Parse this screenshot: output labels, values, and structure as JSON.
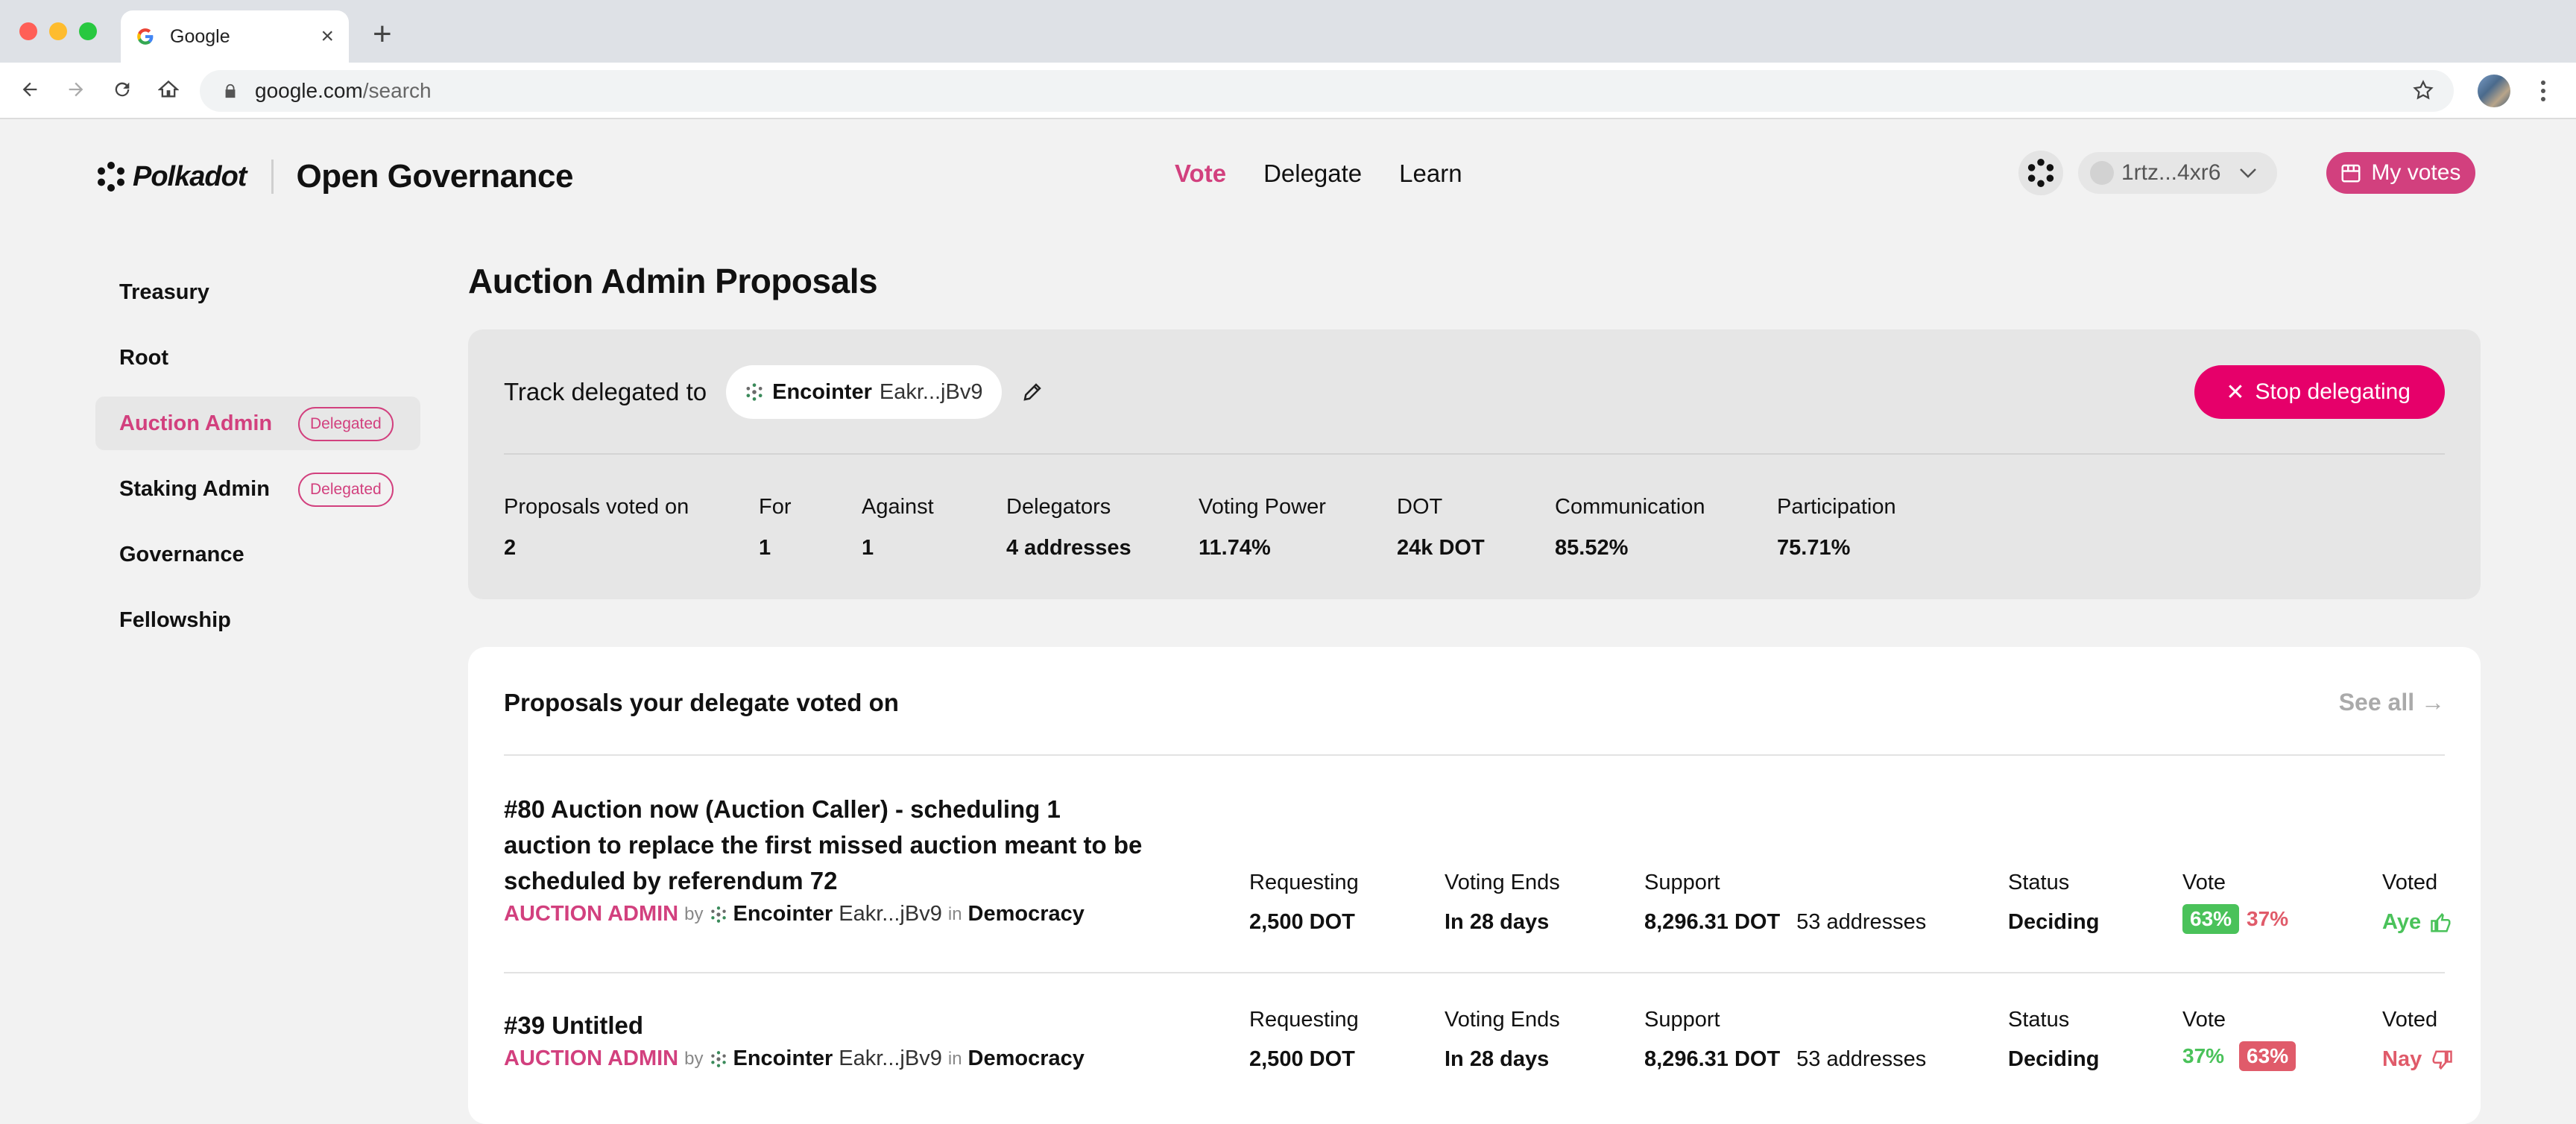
{
  "browser": {
    "tab_title": "Google",
    "url_host": "google.com",
    "url_path": "/search"
  },
  "header": {
    "brand": "Polkadot",
    "app_title": "Open Governance",
    "nav": [
      "Vote",
      "Delegate",
      "Learn"
    ],
    "active_nav": "Vote",
    "account": "1rtz...4xr6",
    "my_votes": "My votes"
  },
  "sidebar": {
    "items": [
      {
        "label": "Treasury",
        "badge": ""
      },
      {
        "label": "Root",
        "badge": ""
      },
      {
        "label": "Auction Admin",
        "badge": "Delegated",
        "active": true
      },
      {
        "label": "Staking Admin",
        "badge": "Delegated"
      },
      {
        "label": "Governance",
        "badge": ""
      },
      {
        "label": "Fellowship",
        "badge": ""
      }
    ]
  },
  "main": {
    "title": "Auction Admin Proposals",
    "track": {
      "label": "Track delegated to",
      "delegate_name": "Encointer",
      "delegate_address": "Eakr...jBv9",
      "stop_label": "Stop delegating",
      "stats": [
        {
          "k": "Proposals voted on",
          "v": "2"
        },
        {
          "k": "For",
          "v": "1"
        },
        {
          "k": "Against",
          "v": "1"
        },
        {
          "k": "Delegators",
          "v": "4 addresses"
        },
        {
          "k": "Voting Power",
          "v": "11.74%"
        },
        {
          "k": "DOT",
          "v": "24k DOT"
        },
        {
          "k": "Communication",
          "v": "85.52%"
        },
        {
          "k": "Participation",
          "v": "75.71%"
        }
      ]
    },
    "proposals": {
      "heading": "Proposals your delegate voted on",
      "see_all": "See all →",
      "labels": {
        "requesting": "Requesting",
        "voting_ends": "Voting Ends",
        "support": "Support",
        "status": "Status",
        "vote": "Vote",
        "voted": "Voted",
        "by": "by",
        "in": "in"
      },
      "rows": [
        {
          "title": "#80 Auction now (Auction Caller) - scheduling 1 auction to replace the first missed auction meant to be scheduled by referendum 72",
          "track": "AUCTION ADMIN",
          "author_name": "Encointer",
          "author_address": "Eakr...jBv9",
          "origin": "Democracy",
          "requesting": "2,500 DOT",
          "voting_ends": "In 28 days",
          "support": "8,296.31 DOT",
          "support_addresses": "53 addresses",
          "status": "Deciding",
          "aye_pct": "63%",
          "nay_pct": "37%",
          "voted": "Aye"
        },
        {
          "title": "#39 Untitled",
          "track": "AUCTION ADMIN",
          "author_name": "Encointer",
          "author_address": "Eakr...jBv9",
          "origin": "Democracy",
          "requesting": "2,500 DOT",
          "voting_ends": "In 28 days",
          "support": "8,296.31 DOT",
          "support_addresses": "53 addresses",
          "status": "Deciding",
          "aye_pct": "37%",
          "nay_pct": "63%",
          "voted": "Nay"
        }
      ]
    }
  },
  "colors": {
    "accent": "#d2407e",
    "stop_button": "#e6006a",
    "aye": "#4ac25a",
    "nay": "#e05b6a"
  },
  "icons": [
    "google-favicon",
    "back-arrow-icon",
    "forward-arrow-icon",
    "reload-icon",
    "home-icon",
    "lock-icon",
    "star-icon",
    "polkadot-logo-icon",
    "network-icon",
    "chevron-down-icon",
    "ballot-icon",
    "encointer-icon",
    "pencil-icon",
    "close-icon",
    "thumbs-up-icon",
    "thumbs-down-icon"
  ]
}
